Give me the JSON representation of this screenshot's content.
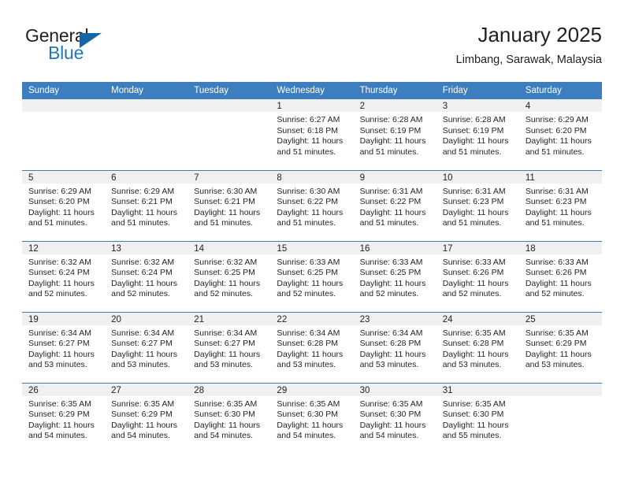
{
  "brand": {
    "name_part1": "General",
    "name_part2": "Blue",
    "triangle_color": "#1566a8",
    "blue_color": "#2277bb"
  },
  "header": {
    "title": "January 2025",
    "subtitle": "Limbang, Sarawak, Malaysia"
  },
  "calendar": {
    "header_color": "#3d7ebf",
    "daynum_band_color": "#f0f0f0",
    "weekdays": [
      "Sunday",
      "Monday",
      "Tuesday",
      "Wednesday",
      "Thursday",
      "Friday",
      "Saturday"
    ],
    "weeks": [
      [
        {
          "day": "",
          "sunrise": "",
          "sunset": "",
          "daylight1": "",
          "daylight2": ""
        },
        {
          "day": "",
          "sunrise": "",
          "sunset": "",
          "daylight1": "",
          "daylight2": ""
        },
        {
          "day": "",
          "sunrise": "",
          "sunset": "",
          "daylight1": "",
          "daylight2": ""
        },
        {
          "day": "1",
          "sunrise": "Sunrise: 6:27 AM",
          "sunset": "Sunset: 6:18 PM",
          "daylight1": "Daylight: 11 hours",
          "daylight2": "and 51 minutes."
        },
        {
          "day": "2",
          "sunrise": "Sunrise: 6:28 AM",
          "sunset": "Sunset: 6:19 PM",
          "daylight1": "Daylight: 11 hours",
          "daylight2": "and 51 minutes."
        },
        {
          "day": "3",
          "sunrise": "Sunrise: 6:28 AM",
          "sunset": "Sunset: 6:19 PM",
          "daylight1": "Daylight: 11 hours",
          "daylight2": "and 51 minutes."
        },
        {
          "day": "4",
          "sunrise": "Sunrise: 6:29 AM",
          "sunset": "Sunset: 6:20 PM",
          "daylight1": "Daylight: 11 hours",
          "daylight2": "and 51 minutes."
        }
      ],
      [
        {
          "day": "5",
          "sunrise": "Sunrise: 6:29 AM",
          "sunset": "Sunset: 6:20 PM",
          "daylight1": "Daylight: 11 hours",
          "daylight2": "and 51 minutes."
        },
        {
          "day": "6",
          "sunrise": "Sunrise: 6:29 AM",
          "sunset": "Sunset: 6:21 PM",
          "daylight1": "Daylight: 11 hours",
          "daylight2": "and 51 minutes."
        },
        {
          "day": "7",
          "sunrise": "Sunrise: 6:30 AM",
          "sunset": "Sunset: 6:21 PM",
          "daylight1": "Daylight: 11 hours",
          "daylight2": "and 51 minutes."
        },
        {
          "day": "8",
          "sunrise": "Sunrise: 6:30 AM",
          "sunset": "Sunset: 6:22 PM",
          "daylight1": "Daylight: 11 hours",
          "daylight2": "and 51 minutes."
        },
        {
          "day": "9",
          "sunrise": "Sunrise: 6:31 AM",
          "sunset": "Sunset: 6:22 PM",
          "daylight1": "Daylight: 11 hours",
          "daylight2": "and 51 minutes."
        },
        {
          "day": "10",
          "sunrise": "Sunrise: 6:31 AM",
          "sunset": "Sunset: 6:23 PM",
          "daylight1": "Daylight: 11 hours",
          "daylight2": "and 51 minutes."
        },
        {
          "day": "11",
          "sunrise": "Sunrise: 6:31 AM",
          "sunset": "Sunset: 6:23 PM",
          "daylight1": "Daylight: 11 hours",
          "daylight2": "and 51 minutes."
        }
      ],
      [
        {
          "day": "12",
          "sunrise": "Sunrise: 6:32 AM",
          "sunset": "Sunset: 6:24 PM",
          "daylight1": "Daylight: 11 hours",
          "daylight2": "and 52 minutes."
        },
        {
          "day": "13",
          "sunrise": "Sunrise: 6:32 AM",
          "sunset": "Sunset: 6:24 PM",
          "daylight1": "Daylight: 11 hours",
          "daylight2": "and 52 minutes."
        },
        {
          "day": "14",
          "sunrise": "Sunrise: 6:32 AM",
          "sunset": "Sunset: 6:25 PM",
          "daylight1": "Daylight: 11 hours",
          "daylight2": "and 52 minutes."
        },
        {
          "day": "15",
          "sunrise": "Sunrise: 6:33 AM",
          "sunset": "Sunset: 6:25 PM",
          "daylight1": "Daylight: 11 hours",
          "daylight2": "and 52 minutes."
        },
        {
          "day": "16",
          "sunrise": "Sunrise: 6:33 AM",
          "sunset": "Sunset: 6:25 PM",
          "daylight1": "Daylight: 11 hours",
          "daylight2": "and 52 minutes."
        },
        {
          "day": "17",
          "sunrise": "Sunrise: 6:33 AM",
          "sunset": "Sunset: 6:26 PM",
          "daylight1": "Daylight: 11 hours",
          "daylight2": "and 52 minutes."
        },
        {
          "day": "18",
          "sunrise": "Sunrise: 6:33 AM",
          "sunset": "Sunset: 6:26 PM",
          "daylight1": "Daylight: 11 hours",
          "daylight2": "and 52 minutes."
        }
      ],
      [
        {
          "day": "19",
          "sunrise": "Sunrise: 6:34 AM",
          "sunset": "Sunset: 6:27 PM",
          "daylight1": "Daylight: 11 hours",
          "daylight2": "and 53 minutes."
        },
        {
          "day": "20",
          "sunrise": "Sunrise: 6:34 AM",
          "sunset": "Sunset: 6:27 PM",
          "daylight1": "Daylight: 11 hours",
          "daylight2": "and 53 minutes."
        },
        {
          "day": "21",
          "sunrise": "Sunrise: 6:34 AM",
          "sunset": "Sunset: 6:27 PM",
          "daylight1": "Daylight: 11 hours",
          "daylight2": "and 53 minutes."
        },
        {
          "day": "22",
          "sunrise": "Sunrise: 6:34 AM",
          "sunset": "Sunset: 6:28 PM",
          "daylight1": "Daylight: 11 hours",
          "daylight2": "and 53 minutes."
        },
        {
          "day": "23",
          "sunrise": "Sunrise: 6:34 AM",
          "sunset": "Sunset: 6:28 PM",
          "daylight1": "Daylight: 11 hours",
          "daylight2": "and 53 minutes."
        },
        {
          "day": "24",
          "sunrise": "Sunrise: 6:35 AM",
          "sunset": "Sunset: 6:28 PM",
          "daylight1": "Daylight: 11 hours",
          "daylight2": "and 53 minutes."
        },
        {
          "day": "25",
          "sunrise": "Sunrise: 6:35 AM",
          "sunset": "Sunset: 6:29 PM",
          "daylight1": "Daylight: 11 hours",
          "daylight2": "and 53 minutes."
        }
      ],
      [
        {
          "day": "26",
          "sunrise": "Sunrise: 6:35 AM",
          "sunset": "Sunset: 6:29 PM",
          "daylight1": "Daylight: 11 hours",
          "daylight2": "and 54 minutes."
        },
        {
          "day": "27",
          "sunrise": "Sunrise: 6:35 AM",
          "sunset": "Sunset: 6:29 PM",
          "daylight1": "Daylight: 11 hours",
          "daylight2": "and 54 minutes."
        },
        {
          "day": "28",
          "sunrise": "Sunrise: 6:35 AM",
          "sunset": "Sunset: 6:30 PM",
          "daylight1": "Daylight: 11 hours",
          "daylight2": "and 54 minutes."
        },
        {
          "day": "29",
          "sunrise": "Sunrise: 6:35 AM",
          "sunset": "Sunset: 6:30 PM",
          "daylight1": "Daylight: 11 hours",
          "daylight2": "and 54 minutes."
        },
        {
          "day": "30",
          "sunrise": "Sunrise: 6:35 AM",
          "sunset": "Sunset: 6:30 PM",
          "daylight1": "Daylight: 11 hours",
          "daylight2": "and 54 minutes."
        },
        {
          "day": "31",
          "sunrise": "Sunrise: 6:35 AM",
          "sunset": "Sunset: 6:30 PM",
          "daylight1": "Daylight: 11 hours",
          "daylight2": "and 55 minutes."
        },
        {
          "day": "",
          "sunrise": "",
          "sunset": "",
          "daylight1": "",
          "daylight2": ""
        }
      ]
    ]
  }
}
